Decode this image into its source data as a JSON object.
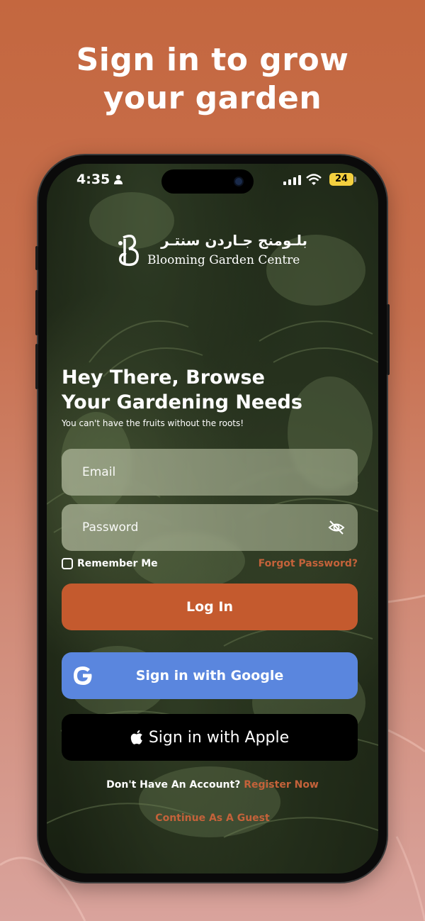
{
  "headline": {
    "line1": "Sign in to grow",
    "line2": "your garden"
  },
  "status_bar": {
    "time": "4:35",
    "battery": "24"
  },
  "logo": {
    "arabic": "بلـومنج جـاردن سنتـر",
    "english": "Blooming Garden Centre"
  },
  "hero": {
    "title_line1": "Hey There, Browse",
    "title_line2": "Your Gardening Needs",
    "subtitle": "You can't have the fruits without the roots!"
  },
  "form": {
    "email_placeholder": "Email",
    "password_placeholder": "Password",
    "remember_label": "Remember Me",
    "forgot_label": "Forgot Password?"
  },
  "buttons": {
    "login": "Log In",
    "google": "Sign in with Google",
    "apple": "Sign in with Apple"
  },
  "footer": {
    "register_prompt": "Don't Have An Account?",
    "register_link": "Register Now",
    "guest": "Continue As A Guest"
  },
  "colors": {
    "accent": "#c45a2e",
    "google": "#5a86de",
    "apple": "#000000"
  }
}
